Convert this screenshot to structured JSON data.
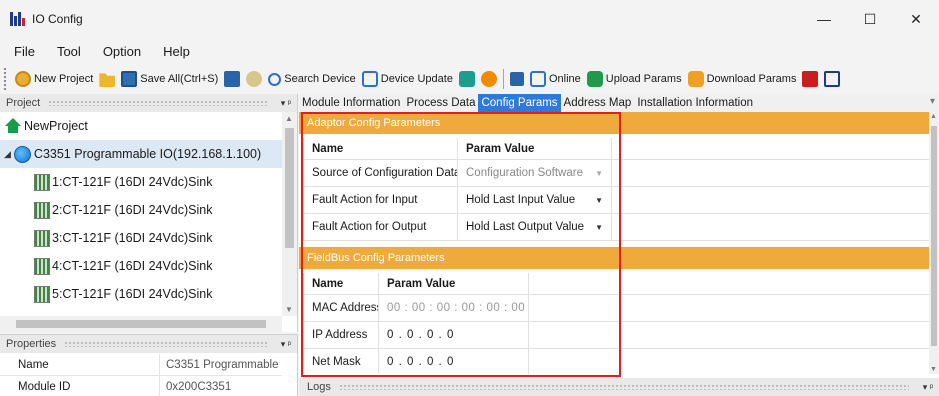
{
  "window": {
    "title": "IO Config",
    "minimize": "—",
    "maximize": "☐",
    "close": "✕"
  },
  "menu": [
    "File",
    "Tool",
    "Option",
    "Help"
  ],
  "toolbar": {
    "new_project": "New Project",
    "save_all": "Save All(Ctrl+S)",
    "search_device": "Search Device",
    "device_update": "Device Update",
    "online": "Online",
    "upload_params": "Upload Params",
    "download_params": "Download Params"
  },
  "project_pane": {
    "header": "Project",
    "pin": "▾ ᵖ",
    "root": "NewProject",
    "device": "C3351 Programmable IO(192.168.1.100)",
    "modules": [
      "1:CT-121F (16DI 24Vdc)Sink",
      "2:CT-121F (16DI 24Vdc)Sink",
      "3:CT-121F (16DI 24Vdc)Sink",
      "4:CT-121F (16DI 24Vdc)Sink",
      "5:CT-121F (16DI 24Vdc)Sink"
    ]
  },
  "properties_pane": {
    "header": "Properties",
    "rows": [
      {
        "name": "Name",
        "value": "C3351 Programmable"
      },
      {
        "name": "Module ID",
        "value": "0x200C3351"
      }
    ]
  },
  "tabs": [
    "Module Information",
    "Process Data",
    "Config Params",
    "Address Map",
    "Installation Information"
  ],
  "active_tab": "Config Params",
  "adaptor_section": {
    "title": "Adaptor Config Parameters",
    "col_name": "Name",
    "col_value": "Param Value",
    "rows": [
      {
        "name": "Source of Configuration Data",
        "value": "Configuration Software",
        "disabled": true
      },
      {
        "name": "Fault Action for Input",
        "value": "Hold Last Input Value",
        "disabled": false
      },
      {
        "name": "Fault Action for Output",
        "value": "Hold Last Output Value",
        "disabled": false
      }
    ]
  },
  "fieldbus_section": {
    "title": "FieldBus Config Parameters",
    "col_name": "Name",
    "col_value": "Param Value",
    "rows": [
      {
        "name": "MAC Address",
        "value": "00 : 00 : 00 : 00 : 00 : 00"
      },
      {
        "name": "IP Address",
        "value": "0  .  0  .  0  .  0"
      },
      {
        "name": "Net Mask",
        "value": "0  .  0  .  0  .  0"
      }
    ]
  },
  "logs_pane": {
    "header": "Logs",
    "pin": "▾ ᵖ"
  },
  "colors": {
    "accent": "#2f7ad6",
    "section": "#f0aa3c",
    "highlight": "#e02020"
  }
}
